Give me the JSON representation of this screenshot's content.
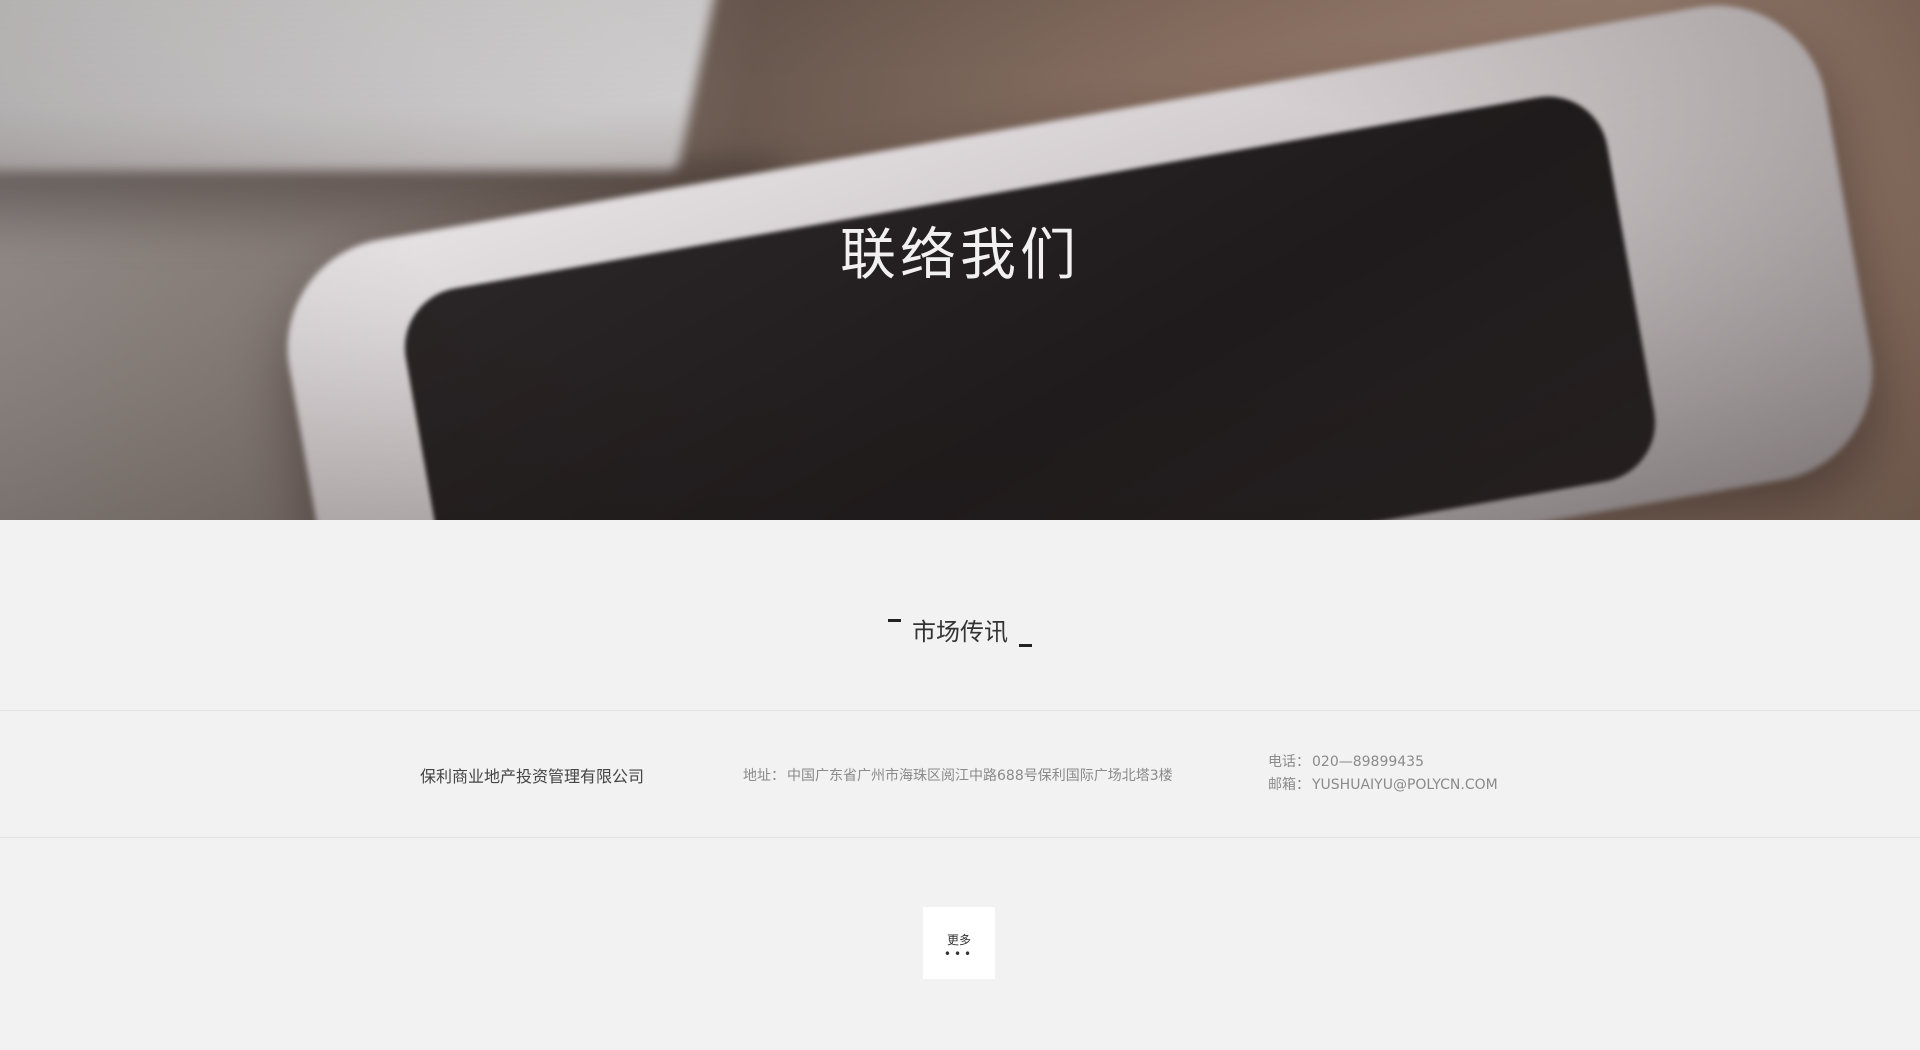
{
  "hero": {
    "title": "联络我们"
  },
  "section": {
    "title": "市场传讯"
  },
  "info": {
    "company": "保利商业地产投资管理有限公司",
    "address_label": "地址：",
    "address_value": "中国广东省广州市海珠区阅江中路688号保利国际广场北塔3楼",
    "phone_label": "电话：",
    "phone_value": "020—89899435",
    "email_label": "邮箱：",
    "email_value": "YUSHUAIYU@POLYCN.COM"
  },
  "more_button": {
    "label": "更多",
    "dots": "•••"
  }
}
